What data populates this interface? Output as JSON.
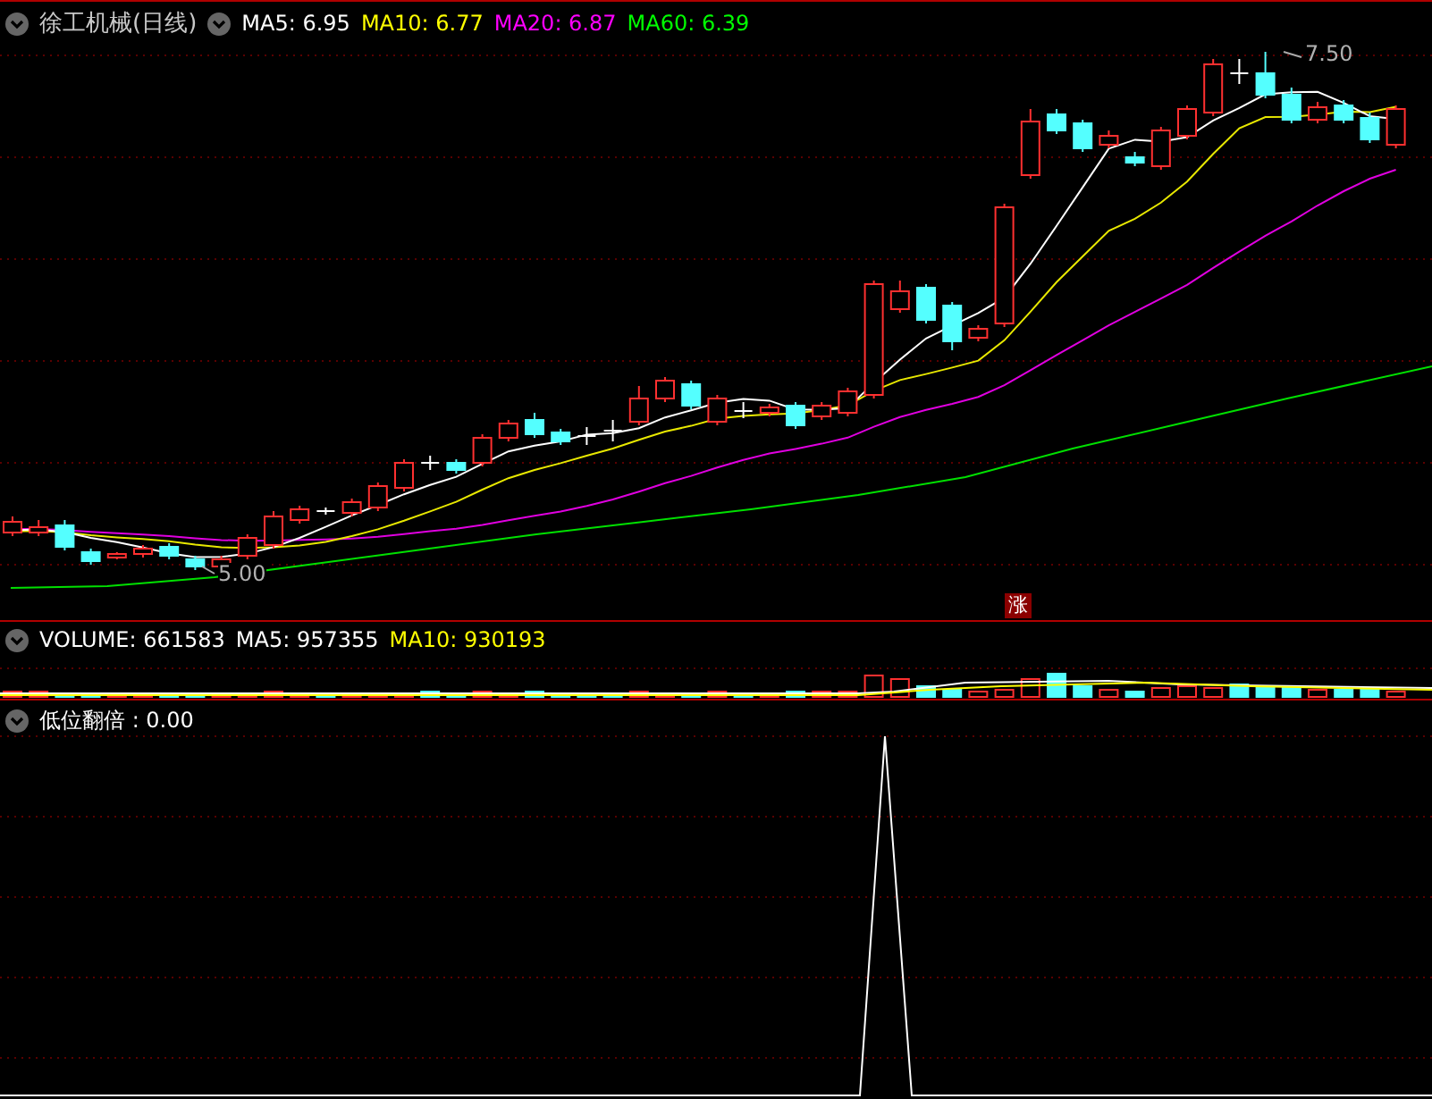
{
  "title": "徐工机械(日线)",
  "ma_legend": [
    {
      "label": "MA5: 6.95",
      "color": "#ffffff"
    },
    {
      "label": "MA10: 6.77",
      "color": "#ffff00"
    },
    {
      "label": "MA20: 6.87",
      "color": "#ff00ff"
    },
    {
      "label": "MA60: 6.39",
      "color": "#00ff00"
    }
  ],
  "price_labels": {
    "high": "7.50",
    "low": "5.00"
  },
  "badge": "涨",
  "volume_legend": [
    {
      "label": "VOLUME: 661583",
      "color": "#ffffff"
    },
    {
      "label": "MA5: 957355",
      "color": "#ffffff"
    },
    {
      "label": "MA10: 930193",
      "color": "#ffff00"
    }
  ],
  "indicator_legend": [
    {
      "label": "低位翻倍 : 0.00",
      "color": "#ffffff"
    }
  ]
}
